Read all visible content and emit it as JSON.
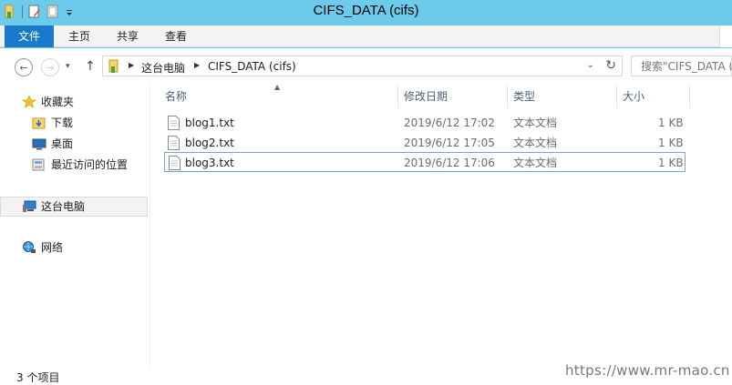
{
  "window": {
    "title": "CIFS_DATA (cifs)"
  },
  "ribbon": {
    "tabs": [
      {
        "label": "文件"
      },
      {
        "label": "主页"
      },
      {
        "label": "共享"
      },
      {
        "label": "查看"
      }
    ]
  },
  "address": {
    "crumbs": [
      "这台电脑",
      "CIFS_DATA (cifs)"
    ],
    "search_placeholder": "搜索\"CIFS_DATA (cifs)\""
  },
  "nav": {
    "favorites": "收藏夹",
    "downloads": "下载",
    "desktop": "桌面",
    "recent": "最近访问的位置",
    "this_pc": "这台电脑",
    "network": "网络"
  },
  "columns": {
    "name": "名称",
    "modified": "修改日期",
    "type": "类型",
    "size": "大小"
  },
  "files": [
    {
      "name": "blog1.txt",
      "modified": "2019/6/12 17:02",
      "type": "文本文档",
      "size": "1 KB"
    },
    {
      "name": "blog2.txt",
      "modified": "2019/6/12 17:05",
      "type": "文本文档",
      "size": "1 KB"
    },
    {
      "name": "blog3.txt",
      "modified": "2019/6/12 17:06",
      "type": "文本文档",
      "size": "1 KB"
    }
  ],
  "status": {
    "count": "3 个项目"
  },
  "watermark": "https://www.mr-mao.cn",
  "colors": {
    "titlebar": "#6ccbea",
    "file_tab": "#1979ca",
    "ribbon": "#f3f3f3"
  }
}
